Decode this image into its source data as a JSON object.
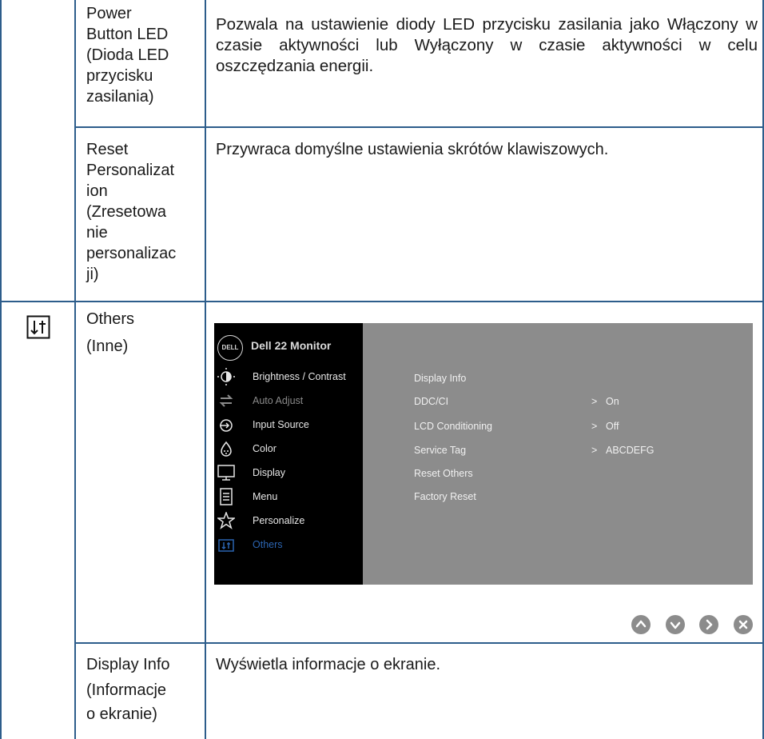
{
  "rows": [
    {
      "item": "Power Button LED (Dioda LED przycisku zasilania)",
      "item_lines": [
        "Power",
        "Button LED",
        "(Dioda LED",
        "przycisku",
        "zasilania)"
      ],
      "description": "Pozwala na ustawienie diody LED przycisku zasilania jako Włączony w czasie aktywności lub Wyłączony w czasie aktywności w celu oszczędzania energii."
    },
    {
      "item": "Reset Personalization (Zresetowanie personalizacji)",
      "item_lines": [
        "Reset",
        "Personalizat",
        "ion",
        "(Zresetowa",
        "nie",
        "personalizac",
        "ji)"
      ],
      "description": "Przywraca domyślne ustawienia skrótów klawiszowych."
    },
    {
      "icon": "others-icon",
      "item": "Others",
      "item_sub": "(Inne)"
    },
    {
      "item": "Display Info",
      "item_lines": [
        "(Informacje",
        "o ekranie)"
      ],
      "description": "Wyświetla informacje o ekranie."
    }
  ],
  "osd": {
    "logo": "DELL",
    "title": "Dell 22 Monitor",
    "menu": [
      {
        "label": "Brightness / Contrast",
        "icon": "brightness-icon",
        "dim": false
      },
      {
        "label": "Auto Adjust",
        "icon": "auto-adjust-icon",
        "dim": true
      },
      {
        "label": "Input Source",
        "icon": "input-source-icon",
        "dim": false
      },
      {
        "label": "Color",
        "icon": "color-icon",
        "dim": false
      },
      {
        "label": "Display",
        "icon": "display-icon",
        "dim": false
      },
      {
        "label": "Menu",
        "icon": "menu-icon",
        "dim": false
      },
      {
        "label": "Personalize",
        "icon": "personalize-icon",
        "dim": false
      },
      {
        "label": "Others",
        "icon": "others-icon",
        "active": true
      }
    ],
    "submenu": [
      {
        "label": "Display Info",
        "value": ""
      },
      {
        "label": "DDC/CI",
        "value": "On"
      },
      {
        "label": "LCD Conditioning",
        "value": "Off"
      },
      {
        "label": "Service Tag",
        "value": "ABCDEFG"
      },
      {
        "label": "Reset Others",
        "value": ""
      },
      {
        "label": "Factory Reset",
        "value": ""
      }
    ],
    "value_chevron": ">",
    "nav_buttons": [
      "up-button",
      "down-button",
      "next-button",
      "exit-button"
    ]
  },
  "colors": {
    "grid": "#2d5d8b",
    "osd_bg": "#8c8c8c",
    "osd_menu_bg": "#000000",
    "osd_active": "#2b64b0",
    "nav_button": "#8c8c8c"
  }
}
